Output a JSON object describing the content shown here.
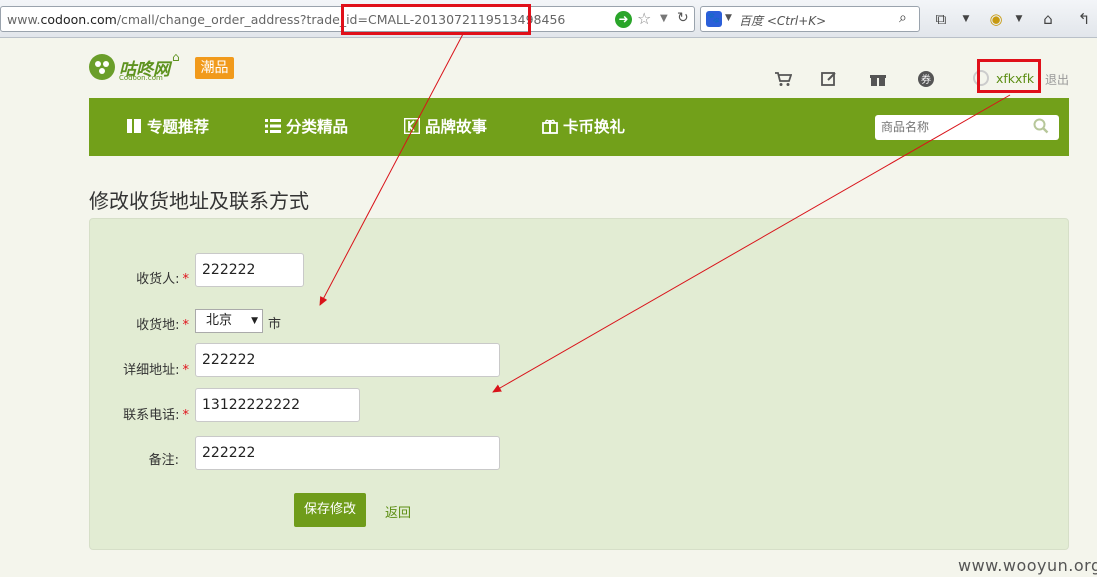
{
  "browser": {
    "url_prefix": "www.",
    "url_domain": "codoon.com",
    "url_path": "/cmall/change_order_address?trade_id=",
    "url_trade_id": "CMALL-2013072119513498456",
    "search_placeholder": "百度 <Ctrl+K>"
  },
  "header": {
    "logo_text": "咕咚网",
    "logo_sub": "Codoon.com",
    "badge": "潮品",
    "username": "xfkxfk",
    "logout": "退出"
  },
  "nav": {
    "items": [
      {
        "label": "专题推荐"
      },
      {
        "label": "分类精品"
      },
      {
        "label": "品牌故事"
      },
      {
        "label": "卡币换礼"
      }
    ],
    "search_placeholder": "商品名称"
  },
  "page": {
    "title": "修改收货地址及联系方式"
  },
  "form": {
    "receiver": {
      "label": "收货人:",
      "value": "222222"
    },
    "region": {
      "label": "收货地:",
      "province": "北京",
      "suffix": "市"
    },
    "address": {
      "label": "详细地址:",
      "value": "222222"
    },
    "phone": {
      "label": "联系电话:",
      "value": "13122222222"
    },
    "note": {
      "label": "备注:",
      "value": "222222"
    },
    "required_mark": "*",
    "save_label": "保存修改",
    "back_label": "返回"
  },
  "watermark": "www.wooyun.org",
  "colors": {
    "brand_green": "#72a01a",
    "highlight_red": "#e0101a",
    "panel": "#e2ecd3",
    "badge_orange": "#f19a1b"
  }
}
